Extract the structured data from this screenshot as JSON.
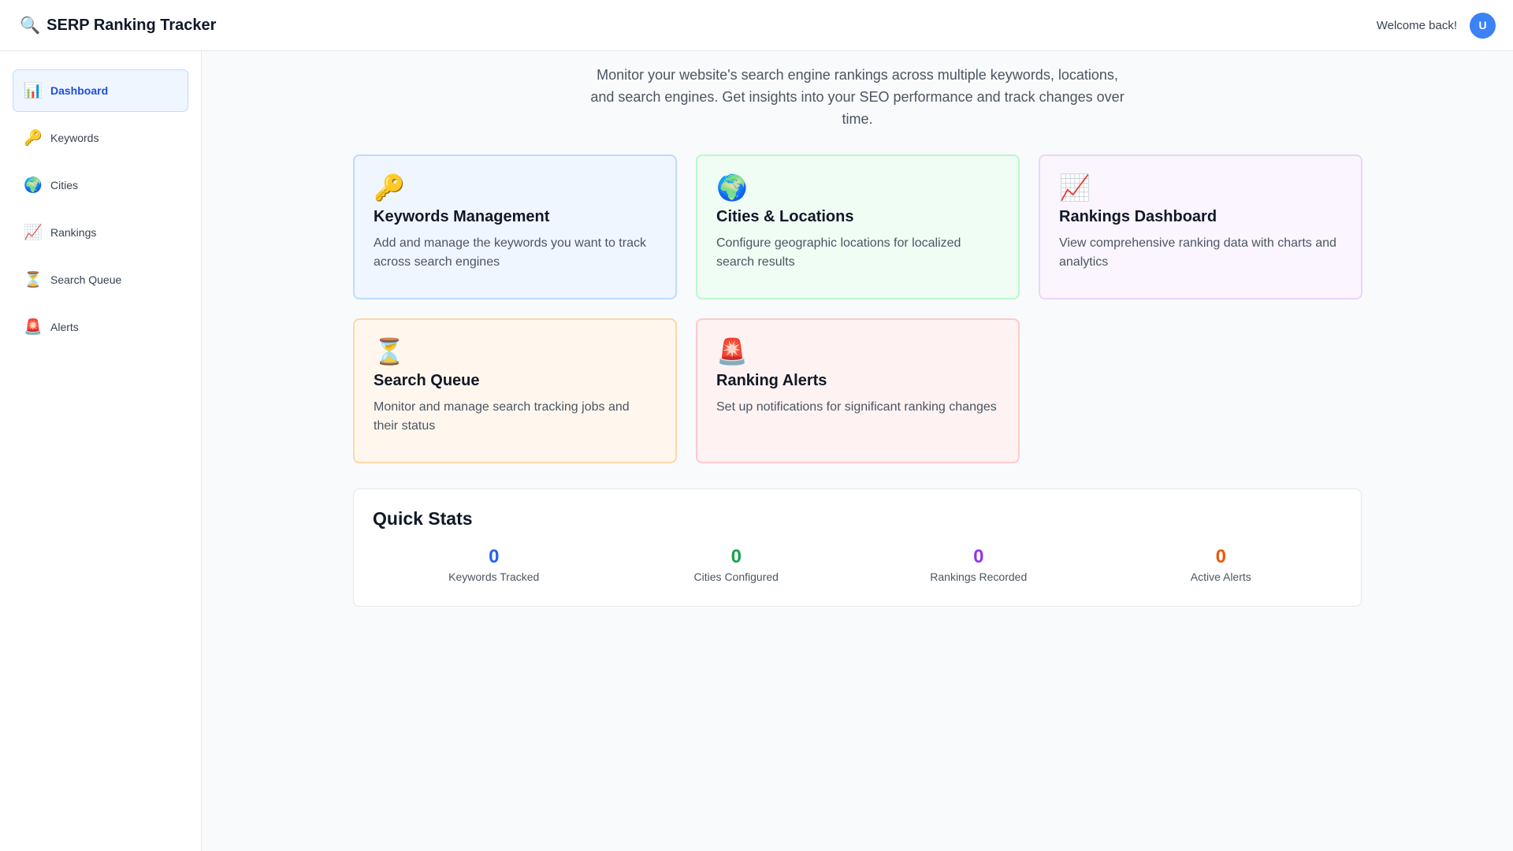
{
  "header": {
    "logo_icon": "🔍",
    "title": "SERP Ranking Tracker",
    "welcome": "Welcome back!",
    "avatar_initial": "U"
  },
  "sidebar": {
    "items": [
      {
        "icon": "📊",
        "label": "Dashboard",
        "active": true
      },
      {
        "icon": "🔑",
        "label": "Keywords"
      },
      {
        "icon": "🌍",
        "label": "Cities"
      },
      {
        "icon": "📈",
        "label": "Rankings"
      },
      {
        "icon": "⏳",
        "label": "Search Queue"
      },
      {
        "icon": "🚨",
        "label": "Alerts"
      }
    ]
  },
  "main": {
    "intro": "Monitor your website's search engine rankings across multiple keywords, locations, and search engines. Get insights into your SEO performance and track changes over time.",
    "cards": [
      {
        "icon": "🔑",
        "title": "Keywords Management",
        "description": "Add and manage the keywords you want to track across search engines",
        "bg": "#eff6ff",
        "border": "#bfdbfe"
      },
      {
        "icon": "🌍",
        "title": "Cities & Locations",
        "description": "Configure geographic locations for localized search results",
        "bg": "#f0fdf4",
        "border": "#bbf7d0"
      },
      {
        "icon": "📈",
        "title": "Rankings Dashboard",
        "description": "View comprehensive ranking data with charts and analytics",
        "bg": "#faf5ff",
        "border": "#e9d5ff"
      },
      {
        "icon": "⏳",
        "title": "Search Queue",
        "description": "Monitor and manage search tracking jobs and their status",
        "bg": "#fff7ed",
        "border": "#fed7aa"
      },
      {
        "icon": "🚨",
        "title": "Ranking Alerts",
        "description": "Set up notifications for significant ranking changes",
        "bg": "#fef2f2",
        "border": "#fecaca"
      }
    ],
    "quick_stats": {
      "title": "Quick Stats",
      "items": [
        {
          "value": "0",
          "label": "Keywords Tracked",
          "color": "#2563eb"
        },
        {
          "value": "0",
          "label": "Cities Configured",
          "color": "#16a34a"
        },
        {
          "value": "0",
          "label": "Rankings Recorded",
          "color": "#9333ea"
        },
        {
          "value": "0",
          "label": "Active Alerts",
          "color": "#ea580c"
        }
      ]
    }
  }
}
